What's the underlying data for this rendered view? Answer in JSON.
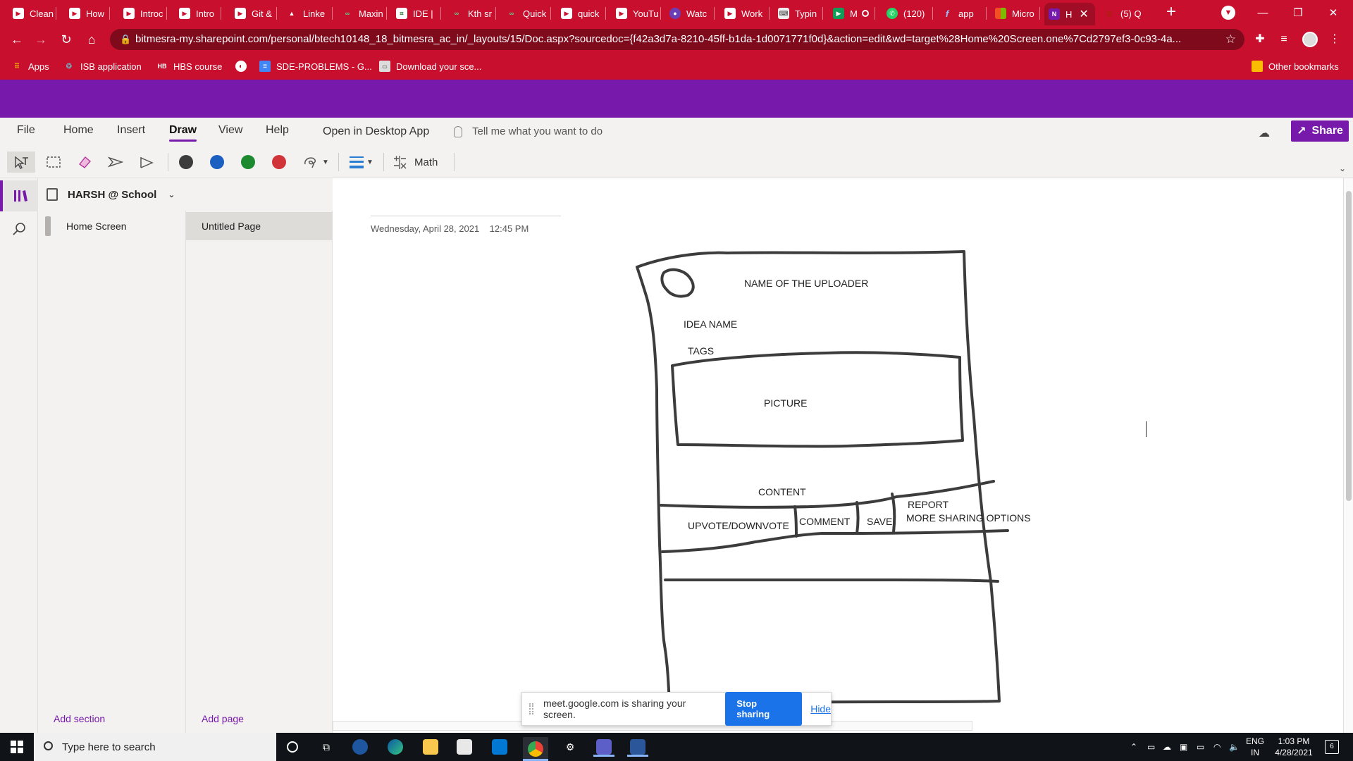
{
  "colors": {
    "chrome_red": "#c8102e",
    "onenote_purple": "#7719aa",
    "pen_black": "#3c3c3c",
    "pen_blue": "#1b5fc1",
    "pen_green": "#1d8a2f",
    "pen_red": "#d13438"
  },
  "browser": {
    "tabs": [
      {
        "label": "Clean",
        "icon": "youtube-icon"
      },
      {
        "label": "How",
        "icon": "youtube-icon"
      },
      {
        "label": "Introc",
        "icon": "youtube-icon"
      },
      {
        "label": "Intro",
        "icon": "youtube-icon"
      },
      {
        "label": "Git &",
        "icon": "youtube-icon"
      },
      {
        "label": "Linke",
        "icon": "mountain-icon"
      },
      {
        "label": "Maxin",
        "icon": "gfg-icon"
      },
      {
        "label": "IDE |",
        "icon": "ide-icon"
      },
      {
        "label": "Kth sr",
        "icon": "gfg-icon"
      },
      {
        "label": "Quick",
        "icon": "gfg-icon"
      },
      {
        "label": "quick",
        "icon": "youtube-icon"
      },
      {
        "label": "YouTu",
        "icon": "youtube-icon"
      },
      {
        "label": "Watc",
        "icon": "watch-icon"
      },
      {
        "label": "Work",
        "icon": "youtube-icon"
      },
      {
        "label": "Typin",
        "icon": "typing-icon"
      },
      {
        "label": "M",
        "icon": "meet-icon"
      },
      {
        "label": "(120)",
        "icon": "whatsapp-icon"
      },
      {
        "label": "app",
        "icon": "f-icon"
      },
      {
        "label": "Micro",
        "icon": "microsoft-icon"
      },
      {
        "label": "H",
        "icon": "onenote-icon"
      },
      {
        "label": "(5) Q",
        "icon": "quora-icon"
      }
    ],
    "url": "bitmesra-my.sharepoint.com/personal/btech10148_18_bitmesra_ac_in/_layouts/15/Doc.aspx?sourcedoc={f42a3d7a-8210-45ff-b1da-1d0071771f0d}&action=edit&wd=target%28Home%20Screen.one%7Cd2797ef3-0c93-4a...",
    "bookmarks": [
      {
        "label": "Apps",
        "icon": "apps-grid-icon"
      },
      {
        "label": "ISB application",
        "icon": "isb-icon"
      },
      {
        "label": "HBS course",
        "icon": "hbs-icon"
      },
      {
        "label": "",
        "icon": "globe-icon"
      },
      {
        "label": "SDE-PROBLEMS - G...",
        "icon": "doc-icon"
      },
      {
        "label": "Download your sce...",
        "icon": "download-icon"
      }
    ],
    "other_bookmarks": "Other bookmarks"
  },
  "onenote": {
    "menu": [
      "File",
      "Home",
      "Insert",
      "Draw",
      "View",
      "Help"
    ],
    "active_menu": "Draw",
    "open_desktop": "Open in Desktop App",
    "tell_me": "Tell me what you want to do",
    "share": "Share",
    "math": "Math",
    "notebook": "HARSH @ School",
    "section": "Home Screen",
    "page": "Untitled Page",
    "add_section": "Add section",
    "add_page": "Add page",
    "date": "Wednesday, April 28, 2021",
    "time": "12:45 PM",
    "sketch_labels": {
      "uploader": "NAME OF THE UPLOADER",
      "idea": "IDEA NAME",
      "tags": "TAGS",
      "picture": "PICTURE",
      "content": "CONTENT",
      "upvote": "UPVOTE/DOWNVOTE",
      "comment": "COMMENT",
      "save": "SAVE",
      "report": "REPORT",
      "more": "MORE SHARING OPTIONS"
    }
  },
  "sharing_bar": {
    "message": "meet.google.com is sharing your screen.",
    "stop": "Stop sharing",
    "hide": "Hide"
  },
  "taskbar": {
    "search_placeholder": "Type here to search",
    "lang1": "ENG",
    "lang2": "IN",
    "time": "1:03 PM",
    "date": "4/28/2021",
    "notifications": "6"
  }
}
